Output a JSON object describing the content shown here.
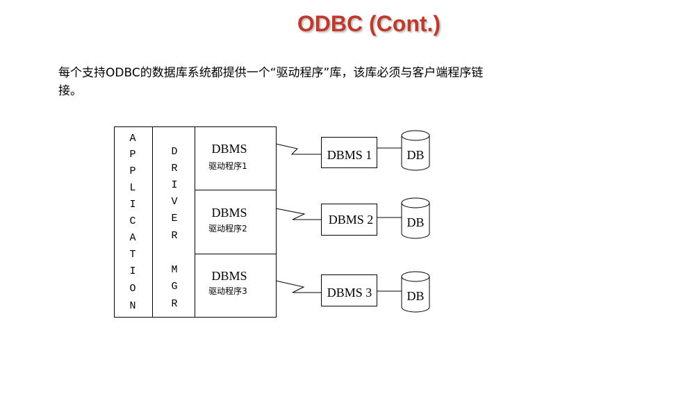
{
  "slide": {
    "title": "ODBC  (Cont.)",
    "paragraph": "每个支持ODBC的数据库系统都提供一个“驱动程序”库，该库必须与客户端程序链接。"
  },
  "diagram": {
    "application_letters": [
      "A",
      "P",
      "P",
      "L",
      "I",
      "C",
      "A",
      "T",
      "I",
      "O",
      "N"
    ],
    "driver_mgr_letters": [
      "D",
      "R",
      "I",
      "V",
      "E",
      "R",
      "",
      "M",
      "G",
      "R"
    ],
    "drivers": [
      {
        "dbms_label": "DBMS",
        "driver_label": "驱动程序1",
        "server_label": "DBMS 1",
        "db_label": "DB"
      },
      {
        "dbms_label": "DBMS",
        "driver_label": "驱动程序2",
        "server_label": "DBMS 2",
        "db_label": "DB"
      },
      {
        "dbms_label": "DBMS",
        "driver_label": "驱动程序3",
        "server_label": "DBMS 3",
        "db_label": "DB"
      }
    ]
  }
}
